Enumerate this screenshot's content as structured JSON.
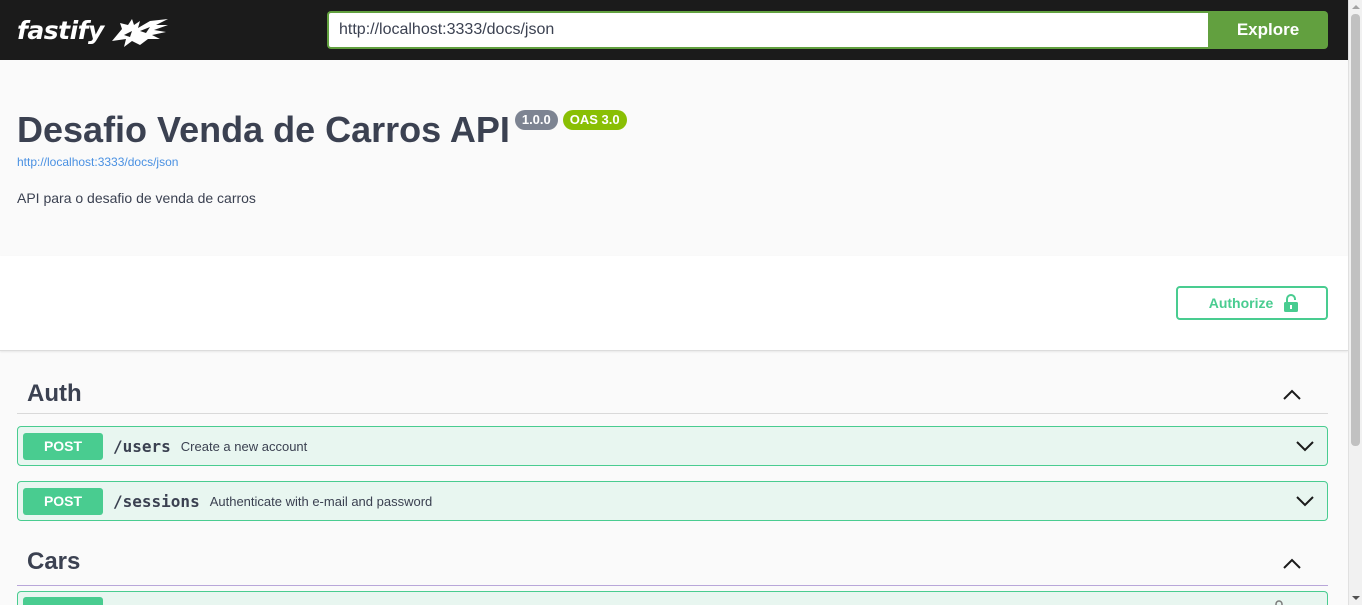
{
  "topbar": {
    "logo_text": "fastify",
    "url_value": "http://localhost:3333/docs/json",
    "explore_label": "Explore"
  },
  "info": {
    "title": "Desafio Venda de Carros API",
    "version": "1.0.0",
    "oas_version": "OAS 3.0",
    "spec_url": "http://localhost:3333/docs/json",
    "description": "API para o desafio de venda de carros"
  },
  "scheme": {
    "authorize_label": "Authorize"
  },
  "tags": [
    {
      "name": "Auth",
      "operations": [
        {
          "method": "POST",
          "path": "/users",
          "summary": "Create a new account"
        },
        {
          "method": "POST",
          "path": "/sessions",
          "summary": "Authenticate with e-mail and password"
        }
      ]
    },
    {
      "name": "Cars",
      "operations": [
        {
          "method": "POST",
          "path": "",
          "summary": ""
        }
      ]
    }
  ],
  "colors": {
    "topbar_bg": "#1b1b1b",
    "accent_green": "#62a03f",
    "post_green": "#49cc90",
    "post_bg": "#e8f6f0",
    "badge_gray": "#7d8492",
    "badge_oas": "#89bf04",
    "link_blue": "#4990e2"
  },
  "icons": {
    "logo_mark": "fastify-cheetah-logo",
    "authorize": "unlocked-padlock-icon",
    "tag_toggle": "chevron-up-icon",
    "op_toggle": "chevron-down-icon"
  }
}
